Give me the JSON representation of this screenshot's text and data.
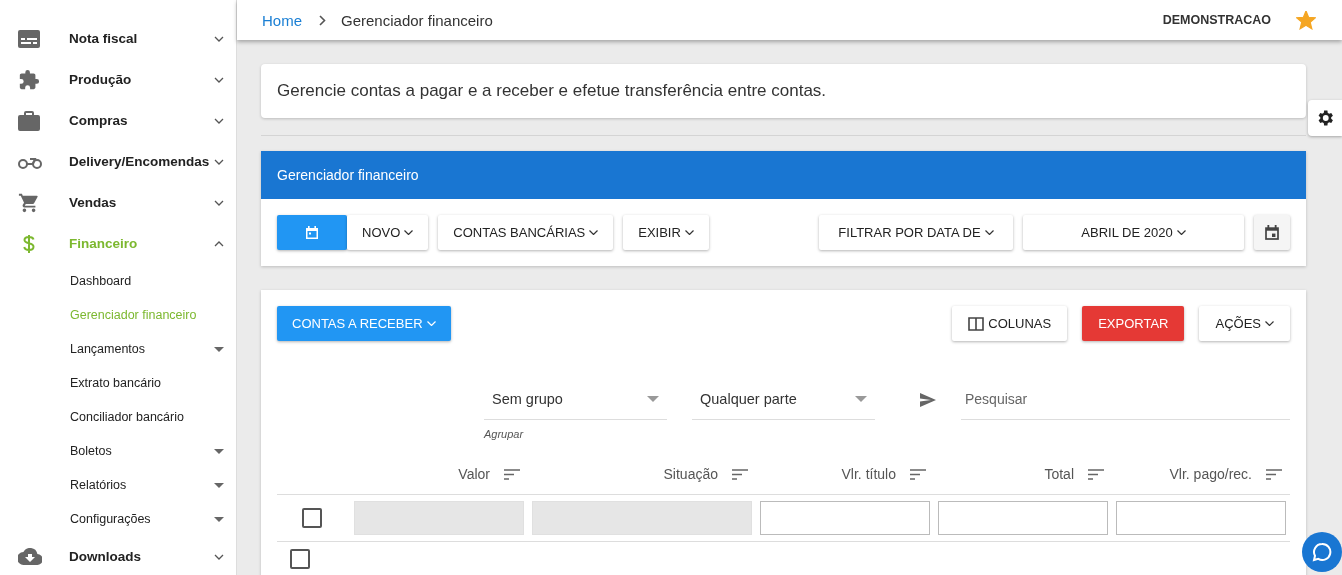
{
  "sidebar": {
    "items": [
      {
        "label": "Nota fiscal",
        "expanded": false,
        "selected": false
      },
      {
        "label": "Produção",
        "expanded": false,
        "selected": false
      },
      {
        "label": "Compras",
        "expanded": false,
        "selected": false
      },
      {
        "label": "Delivery/Encomendas",
        "expanded": false,
        "selected": false
      },
      {
        "label": "Vendas",
        "expanded": false,
        "selected": false
      },
      {
        "label": "Financeiro",
        "expanded": true,
        "selected": true,
        "children": [
          {
            "label": "Dashboard",
            "selected": false,
            "has_submenu": false
          },
          {
            "label": "Gerenciador financeiro",
            "selected": true,
            "has_submenu": false
          },
          {
            "label": "Lançamentos",
            "selected": false,
            "has_submenu": true
          },
          {
            "label": "Extrato bancário",
            "selected": false,
            "has_submenu": false
          },
          {
            "label": "Conciliador bancário",
            "selected": false,
            "has_submenu": false
          },
          {
            "label": "Boletos",
            "selected": false,
            "has_submenu": true
          },
          {
            "label": "Relatórios",
            "selected": false,
            "has_submenu": true
          },
          {
            "label": "Configurações",
            "selected": false,
            "has_submenu": true
          }
        ]
      },
      {
        "label": "Downloads",
        "expanded": false,
        "selected": false
      }
    ]
  },
  "breadcrumb": [
    "Home",
    "Gerenciador financeiro"
  ],
  "account": {
    "name": "DEMONSTRACAO",
    "favorite": true
  },
  "description": "Gerencie contas a pagar e a receber e efetue transferência entre contas.",
  "panel": {
    "title": "Gerenciador financeiro",
    "toolbar_left": [
      {
        "kind": "calendar",
        "selected": true
      },
      {
        "kind": "menu",
        "label": "NOVO"
      },
      {
        "kind": "menu",
        "label": "CONTAS BANCÁRIAS"
      },
      {
        "kind": "menu",
        "label": "EXIBIR"
      }
    ],
    "toolbar_right": [
      {
        "kind": "menu",
        "label": "FILTRAR POR DATA DE"
      },
      {
        "kind": "menu",
        "label": "ABRIL DE 2020"
      },
      {
        "kind": "calendar",
        "selected": false
      }
    ]
  },
  "list": {
    "type_button": "CONTAS A RECEBER",
    "actions": [
      {
        "kind": "columns",
        "label": "COLUNAS"
      },
      {
        "kind": "danger",
        "label": "EXPORTAR"
      },
      {
        "kind": "menu",
        "label": "AÇÕES"
      }
    ],
    "group_select": {
      "value": "Sem grupo",
      "helper": "Agrupar"
    },
    "scope_select": {
      "value": "Qualquer parte"
    },
    "search": {
      "placeholder": "Pesquisar"
    },
    "columns": [
      {
        "label": "Valor",
        "filter_disabled": true
      },
      {
        "label": "Situação",
        "filter_disabled": true
      },
      {
        "label": "Vlr. título",
        "filter_disabled": false
      },
      {
        "label": "Total",
        "filter_disabled": false
      },
      {
        "label": "Vlr. pago/rec.",
        "filter_disabled": false
      }
    ],
    "select_all": {
      "checked": false
    },
    "first_row": {
      "checked": false
    }
  }
}
